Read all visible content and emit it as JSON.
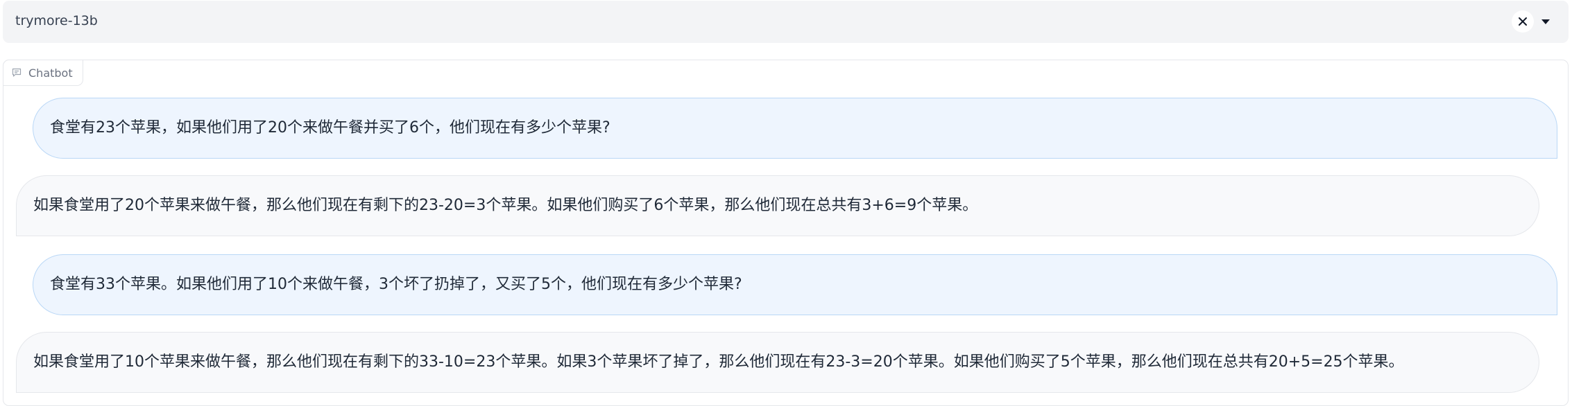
{
  "model_selector": {
    "value": "trymore-13b",
    "clear_icon": "close-icon",
    "dropdown_icon": "caret-down-icon"
  },
  "chatbot": {
    "label": "Chatbot",
    "icon": "chat-icon",
    "messages": [
      {
        "role": "user",
        "text": "食堂有23个苹果，如果他们用了20个来做午餐并买了6个，他们现在有多少个苹果?"
      },
      {
        "role": "bot",
        "text": "如果食堂用了20个苹果来做午餐，那么他们现在有剩下的23-20=3个苹果。如果他们购买了6个苹果，那么他们现在总共有3+6=9个苹果。"
      },
      {
        "role": "user",
        "text": "食堂有33个苹果。如果他们用了10个来做午餐，3个坏了扔掉了，又买了5个，他们现在有多少个苹果?"
      },
      {
        "role": "bot",
        "text": "如果食堂用了10个苹果来做午餐，那么他们现在有剩下的33-10=23个苹果。如果3个苹果坏了掉了，那么他们现在有23-3=20个苹果。如果他们购买了5个苹果，那么他们现在总共有20+5=25个苹果。"
      }
    ]
  },
  "colors": {
    "user_bubble": "#eef5fe",
    "user_border": "#b9d7f6",
    "bot_bubble": "#f8f9fb",
    "bot_border": "#e5e7eb"
  }
}
